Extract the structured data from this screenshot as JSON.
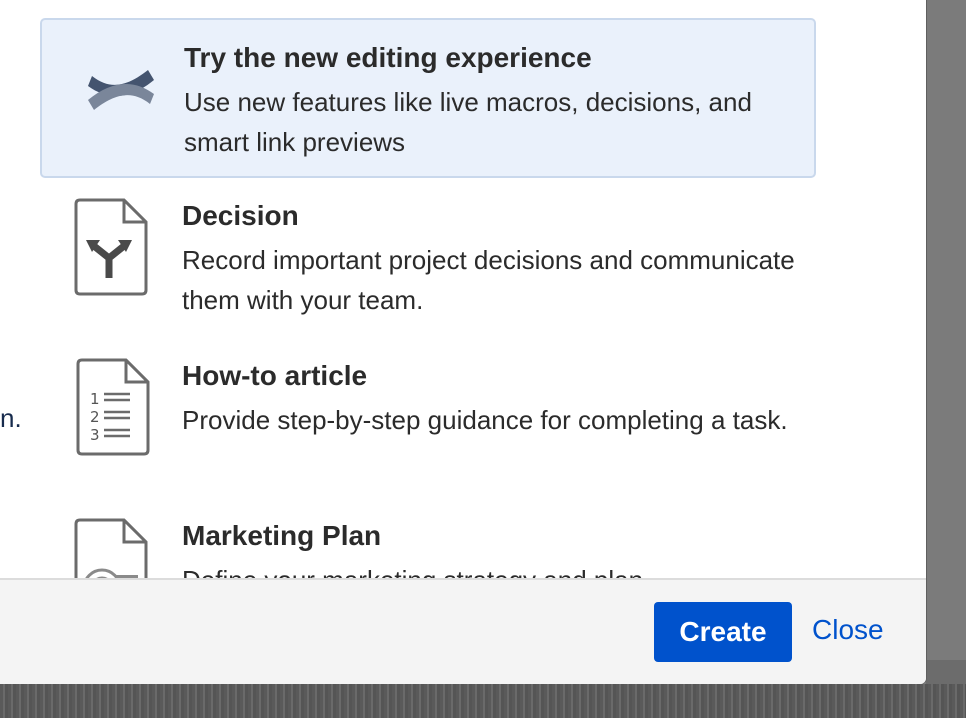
{
  "templates": [
    {
      "icon": "confluence-logo-icon",
      "title": "Try the new editing experience",
      "desc": "Use new features like live macros, decisions, and smart link previews"
    },
    {
      "icon": "decision-document-icon",
      "title": "Decision",
      "desc": "Record important project decisions and communicate them with your team."
    },
    {
      "icon": "numbered-list-document-icon",
      "title": "How-to article",
      "desc": "Provide step-by-step guidance for completing a task."
    },
    {
      "icon": "marketing-plan-document-icon",
      "title": "Marketing Plan",
      "desc": "Define your marketing strategy and plan"
    }
  ],
  "left_partial_text": "n.",
  "footer": {
    "create_label": "Create",
    "close_label": "Close"
  },
  "colors": {
    "accent": "#0052cc",
    "selected_bg": "#eaf1fb",
    "footer_bg": "#f4f4f4"
  }
}
